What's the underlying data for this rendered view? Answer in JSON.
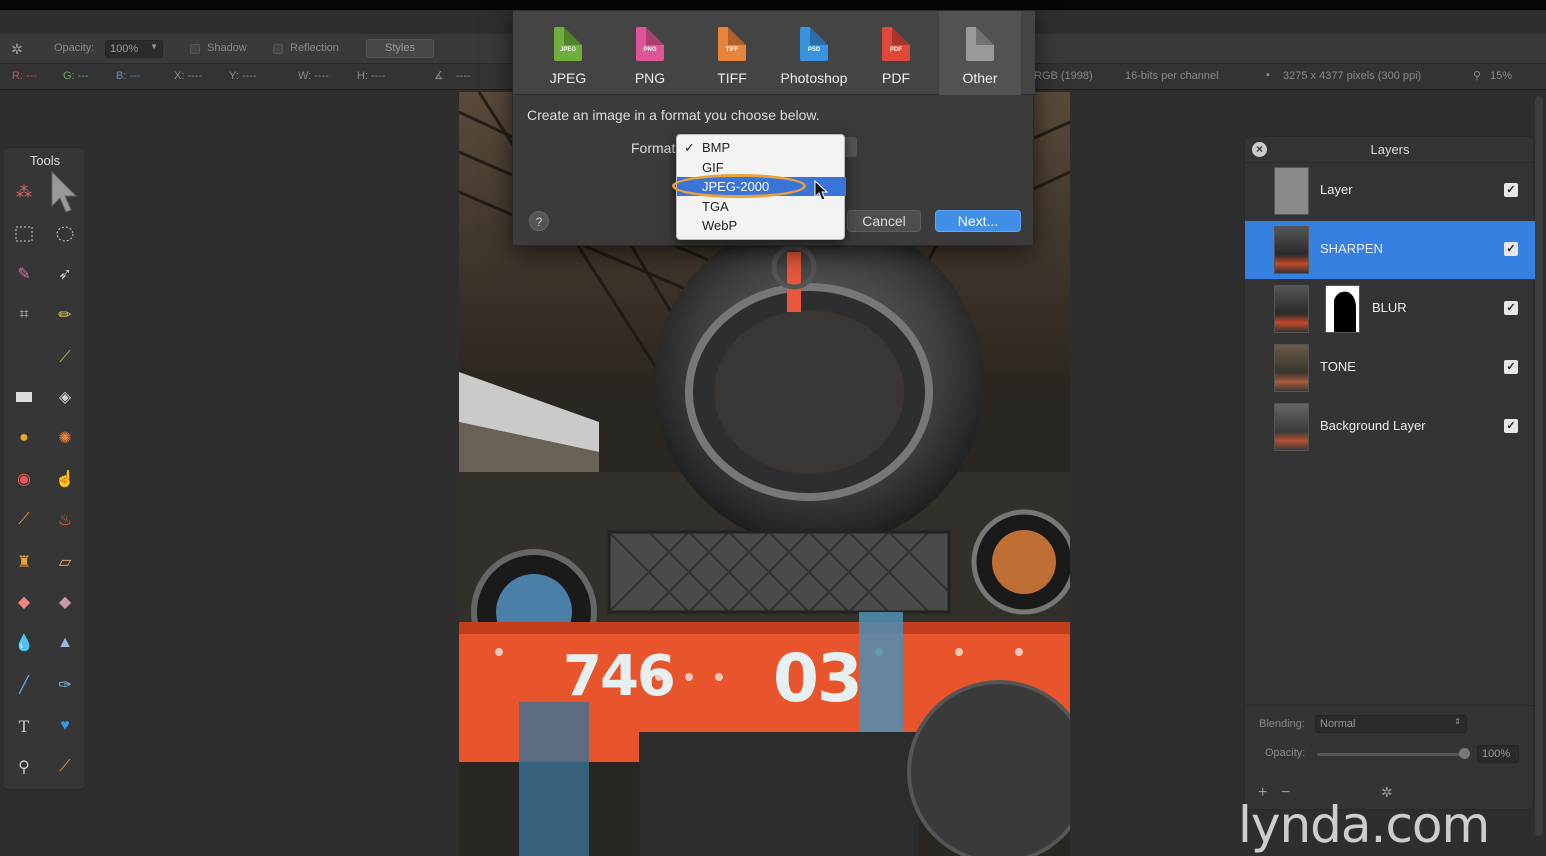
{
  "toolbar": {
    "opacity_label": "Opacity:",
    "opacity_value": "100%",
    "shadow_label": "Shadow",
    "reflection_label": "Reflection",
    "styles_label": "Styles"
  },
  "infobar": {
    "r": "R: ---",
    "g": "G: ---",
    "b": "B: ---",
    "x": "X: ----",
    "y": "Y: ----",
    "w": "W: ----",
    "h": "H: ----",
    "angle": "----",
    "profile": "RGB (1998)",
    "depth": "16-bits per channel",
    "dimensions": "3275 x 4377 pixels (300 ppi)",
    "zoom": "15%"
  },
  "tools": {
    "title": "Tools"
  },
  "export_dialog": {
    "formats": [
      {
        "label": "JPEG",
        "tag": "JPEG",
        "color": "#6fae3c"
      },
      {
        "label": "PNG",
        "tag": "PNG",
        "color": "#e0559a"
      },
      {
        "label": "TIFF",
        "tag": "TIFF",
        "color": "#e8833a"
      },
      {
        "label": "Photoshop",
        "tag": "PSD",
        "color": "#3a93e0"
      },
      {
        "label": "PDF",
        "tag": "PDF",
        "color": "#e0493a"
      },
      {
        "label": "Other",
        "tag": "",
        "color": "#9a9a9a"
      }
    ],
    "selected_format": "Other",
    "prompt": "Create an image in a format you choose below.",
    "format_label": "Format",
    "options": [
      "BMP",
      "GIF",
      "JPEG-2000",
      "TGA",
      "WebP"
    ],
    "checked_option": "BMP",
    "highlighted_option": "JPEG-2000",
    "help_label": "?",
    "cancel_label": "Cancel",
    "next_label": "Next..."
  },
  "layers": {
    "title": "Layers",
    "items": [
      {
        "name": "Layer",
        "visible": "✓"
      },
      {
        "name": "SHARPEN",
        "visible": "✓"
      },
      {
        "name": "BLUR",
        "visible": "✓"
      },
      {
        "name": "TONE",
        "visible": "✓"
      },
      {
        "name": "Background Layer",
        "visible": "✓"
      }
    ],
    "selected": "SHARPEN",
    "blending_label": "Blending:",
    "blending_value": "Normal",
    "opacity_label": "Opacity:",
    "opacity_value": "100%"
  },
  "canvas_numbers": {
    "left": "746",
    "right": "03"
  },
  "watermark": "lynda.com"
}
